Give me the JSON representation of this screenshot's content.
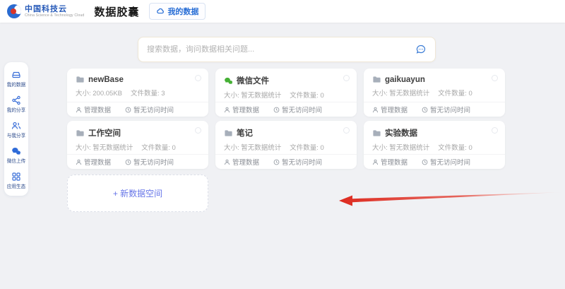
{
  "header": {
    "logo_cn": "中国科技云",
    "logo_en": "China Science & Technology Cloud",
    "app_title": "数据胶囊",
    "my_data_button": "我的数据"
  },
  "sidebar": {
    "items": [
      {
        "label": "我的数据",
        "icon": "drive-icon"
      },
      {
        "label": "我的分享",
        "icon": "share-icon"
      },
      {
        "label": "与我分享",
        "icon": "users-icon"
      },
      {
        "label": "微信上传",
        "icon": "wechat-icon"
      },
      {
        "label": "应用生态",
        "icon": "apps-grid-icon"
      }
    ]
  },
  "search": {
    "placeholder": "搜索数据，询问数据相关问题...",
    "icon": "chat-bubble-icon"
  },
  "cards": [
    {
      "title": "newBase",
      "size": "大小: 200.05KB",
      "files": "文件数量: 3",
      "manage": "管理数据",
      "visit": "暂无访问时间",
      "icon": "folder-icon"
    },
    {
      "title": "微信文件",
      "size": "大小: 暂无数据统计",
      "files": "文件数量: 0",
      "manage": "管理数据",
      "visit": "暂无访问时间",
      "icon": "wechat-green-icon"
    },
    {
      "title": "gaikuayun",
      "size": "大小: 暂无数据统计",
      "files": "文件数量: 0",
      "manage": "管理数据",
      "visit": "暂无访问时间",
      "icon": "folder-icon"
    },
    {
      "title": "工作空间",
      "size": "大小: 暂无数据统计",
      "files": "文件数量: 0",
      "manage": "管理数据",
      "visit": "暂无访问时间",
      "icon": "folder-icon"
    },
    {
      "title": "笔记",
      "size": "大小: 暂无数据统计",
      "files": "文件数量: 0",
      "manage": "管理数据",
      "visit": "暂无访问时间",
      "icon": "folder-icon"
    },
    {
      "title": "实验数据",
      "size": "大小: 暂无数据统计",
      "files": "文件数量: 0",
      "manage": "管理数据",
      "visit": "暂无访问时间",
      "icon": "folder-icon"
    }
  ],
  "new_space": {
    "label": "+ 新数据空间"
  },
  "colors": {
    "accent_blue": "#2a6fd6",
    "logo_red": "#d8342a",
    "wechat_green": "#45b035",
    "new_space_blue": "#6776e8",
    "arrow_red": "#dd2b20",
    "page_bg": "#f0f1f4"
  }
}
